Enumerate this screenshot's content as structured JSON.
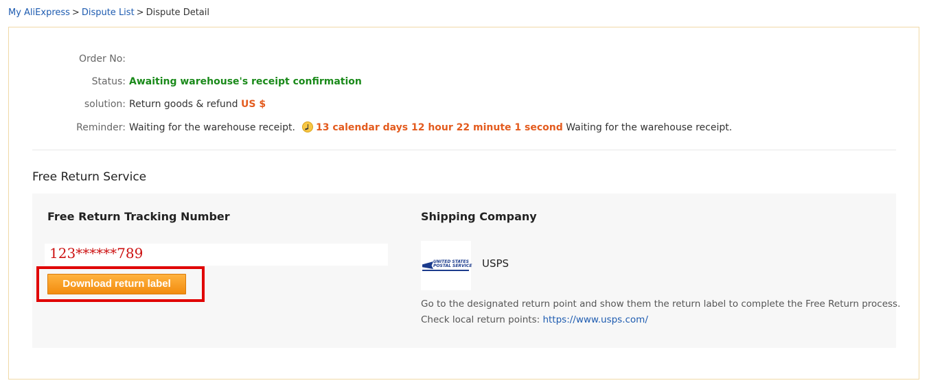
{
  "breadcrumb": {
    "items": [
      "My AliExpress",
      "Dispute List"
    ],
    "separator": ">",
    "current": "Dispute Detail"
  },
  "order": {
    "order_no_label": "Order No:",
    "order_no_value": "",
    "status_label": "Status:",
    "status_value": "Awaiting warehouse's receipt confirmation",
    "solution_label": "solution:",
    "solution_text": "Return goods & refund",
    "solution_amount": "US $",
    "reminder_label": "Reminder:",
    "reminder_prefix": "Waiting for the warehouse receipt.",
    "reminder_countdown": "13 calendar days 12 hour 22 minute 1 second",
    "reminder_suffix": "Waiting for the warehouse receipt.",
    "reminder_icon": "clock-icon"
  },
  "free_return": {
    "section_title": "Free Return Service",
    "tracking_title": "Free Return Tracking Number",
    "tracking_number": "123******789",
    "download_label": "Download return label",
    "shipping_title": "Shipping Company",
    "logo_text_line1": "UNITED STATES",
    "logo_text_line2": "POSTAL SERVICE",
    "carrier_name": "USPS",
    "instruction_line1": "Go to the designated return point and show them the return label to complete the Free Return process.",
    "instruction_line2_prefix": "Check local return points:",
    "instruction_link": "https://www.usps.com/"
  },
  "colors": {
    "link": "#1d5bb0",
    "status_green": "#1a8a1a",
    "accent_orange": "#e35b1e",
    "button_orange": "#f28c0f",
    "highlight_red": "#e00000",
    "panel_border": "#f0d9a6"
  }
}
